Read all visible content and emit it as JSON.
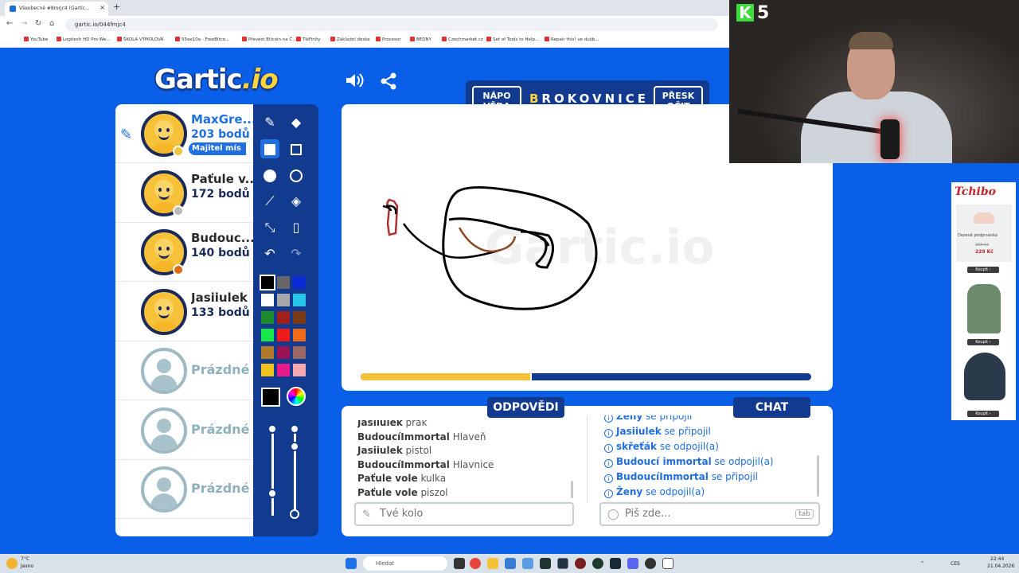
{
  "browser": {
    "tab_title": "Všeobecné #8mrjc4 (Gartic...",
    "url": "gartic.io/044fmjc4",
    "bookmarks": [
      "YouTube",
      "Logitech HD Pro We...",
      "ŠKOLA VÝMOLOVÁ",
      "55ee10o - FreeBitco...",
      "Převést Bitcoin na Č...",
      "TikFinity",
      "Základní deska",
      "Procesor",
      "BEDNY",
      "Czechmarket.cz",
      "Set of Tools to Help...",
      "Repair this! ve dušb..."
    ]
  },
  "logo": {
    "main": "Gartic",
    "suffix": ".io"
  },
  "header_icons": [
    "speaker-icon",
    "share-icon"
  ],
  "word_bar": {
    "skip_left": "NÁPO\nVĚDA",
    "word": "BROKOVNICE",
    "skip_right": "PŘESK\nOČIT"
  },
  "players": [
    {
      "name": "MaxGre...",
      "points": "203 bodů",
      "badge": "Majitel mís",
      "status_color": "#f2c23a",
      "me": true,
      "drawing": true
    },
    {
      "name": "Paťule v...",
      "points": "172 bodů",
      "status_color": "#b9b9b9"
    },
    {
      "name": "Budouc...",
      "points": "140 bodů",
      "status_color": "#e06b12"
    },
    {
      "name": "Jasiiulek",
      "points": "133 bodů"
    },
    {
      "name": "Prázdné"
    },
    {
      "name": "Prázdné"
    },
    {
      "name": "Prázdné"
    }
  ],
  "palette": [
    "#000000",
    "#666666",
    "#0a2bd6",
    "#ffffff",
    "#a9a9a9",
    "#27c4e8",
    "#1e8c2a",
    "#a0211b",
    "#7a3a16",
    "#17e84a",
    "#ef1a1a",
    "#f06a1a",
    "#b07a2a",
    "#9a1455",
    "#9a6666",
    "#f0c21a",
    "#e81a8a",
    "#f5a8b0"
  ],
  "current_color": "#000000",
  "progress": 0.38,
  "tabs": {
    "answers": "ODPOVĚDI",
    "chat": "CHAT"
  },
  "answers": [
    {
      "user": "Jasiiulek",
      "text": "prak"
    },
    {
      "user": "BudoucíImmortal",
      "text": "Hlaveň"
    },
    {
      "user": "Jasiiulek",
      "text": "pistol"
    },
    {
      "user": "BudoucíImmortal",
      "text": "Hlavnice"
    },
    {
      "user": "Paťule vole",
      "text": "kulka"
    },
    {
      "user": "Paťule vole",
      "text": "piszol"
    }
  ],
  "chat": [
    {
      "user": "Ženy",
      "text": "se připojil"
    },
    {
      "user": "Jasiiulek",
      "text": "se připojil"
    },
    {
      "user": "skřeťák",
      "text": "se odpojil(a)"
    },
    {
      "user": "Budoucí immortal",
      "text": "se odpojil(a)"
    },
    {
      "user": "BudoucíImmortal",
      "text": "se připojil"
    },
    {
      "user": "Ženy",
      "text": "se odpojil(a)"
    }
  ],
  "answer_input": {
    "placeholder": "Tvé kolo"
  },
  "chat_input": {
    "placeholder": "Piš zde...",
    "key_hint": "tab"
  },
  "stream": {
    "k_label": "K",
    "k_count": "5"
  },
  "ad": {
    "brand": "Tchibo",
    "item_text": "Dezeně podprsenka",
    "old_price": "399 Kč",
    "price": "229 Kč",
    "buy": "Koupit ›"
  },
  "taskbar": {
    "weather_temp": "7°C",
    "weather_desc": "Jasno",
    "search": "Hledat",
    "lang": "CES",
    "time": "22:44",
    "date": "21.04.2026"
  }
}
